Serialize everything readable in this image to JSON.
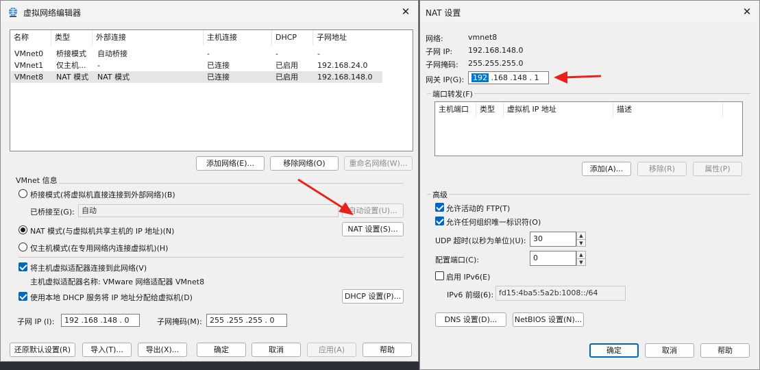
{
  "vne": {
    "title": "虚拟网络编辑器",
    "columns": [
      "名称",
      "类型",
      "外部连接",
      "主机连接",
      "DHCP",
      "子网地址"
    ],
    "rows": [
      [
        "VMnet0",
        "桥接模式",
        "自动桥接",
        "-",
        "-",
        "-"
      ],
      [
        "VMnet1",
        "仅主机...",
        "-",
        "已连接",
        "已启用",
        "192.168.24.0"
      ],
      [
        "VMnet8",
        "NAT 模式",
        "NAT 模式",
        "已连接",
        "已启用",
        "192.168.148.0"
      ]
    ],
    "add_network": "添加网络(E)...",
    "remove_network": "移除网络(O)",
    "rename_network": "重命名网络(W)...",
    "info_group": "VMnet 信息",
    "bridge_mode": "桥接模式(将虚拟机直接连接到外部网络)(B)",
    "bridged_to_label": "已桥接至(G):",
    "bridged_to_value": "自动",
    "auto_settings": "自动设置(U)...",
    "nat_mode": "NAT 模式(与虚拟机共享主机的 IP 地址)(N)",
    "nat_settings": "NAT 设置(S)...",
    "host_only_mode": "仅主机模式(在专用网络内连接虚拟机)(H)",
    "connect_adapter": "将主机虚拟适配器连接到此网络(V)",
    "adapter_name": "主机虚拟适配器名称: VMware 网络适配器 VMnet8",
    "use_dhcp": "使用本地 DHCP 服务将 IP 地址分配给虚拟机(D)",
    "dhcp_settings": "DHCP 设置(P)...",
    "subnet_ip_label": "子网 IP (I):",
    "subnet_ip_value": "192 .168 .148 .  0",
    "subnet_mask_label": "子网掩码(M):",
    "subnet_mask_value": "255 .255 .255 .  0",
    "restore_defaults": "还原默认设置(R)",
    "import": "导入(T)...",
    "export": "导出(X)...",
    "ok": "确定",
    "cancel": "取消",
    "apply": "应用(A)",
    "help": "帮助"
  },
  "nat": {
    "title": "NAT 设置",
    "network_label": "网络:",
    "network_value": "vmnet8",
    "subnet_ip_label": "子网 IP:",
    "subnet_ip_value": "192.168.148.0",
    "subnet_mask_label": "子网掩码:",
    "subnet_mask_value": "255.255.255.0",
    "gateway_label": "网关 IP(G):",
    "gateway_first": "192",
    "gateway_rest": " .168 .148 .  1",
    "port_forward_group": "端口转发(F)",
    "pf_columns": [
      "主机端口",
      "类型",
      "虚拟机 IP 地址",
      "描述"
    ],
    "add": "添加(A)...",
    "remove": "移除(R)",
    "properties": "属性(P)",
    "advanced_group": "高级",
    "allow_active_ftp": "允许活动的 FTP(T)",
    "allow_any_oui": "允许任何组织唯一标识符(O)",
    "udp_timeout_label": "UDP 超时(以秒为单位)(U):",
    "udp_timeout_value": "30",
    "config_port_label": "配置端口(C):",
    "config_port_value": "0",
    "enable_ipv6": "启用 IPv6(E)",
    "ipv6_prefix_label": "IPv6 前缀(6):",
    "ipv6_prefix_value": "fd15:4ba5:5a2b:1008::/64",
    "dns_settings": "DNS 设置(D)...",
    "netbios_settings": "NetBIOS 设置(N)...",
    "ok": "确定",
    "cancel": "取消",
    "help": "帮助"
  },
  "colors": {
    "accent": "#0067c0",
    "arrow": "#e8221b",
    "selection": "#0078d7"
  }
}
